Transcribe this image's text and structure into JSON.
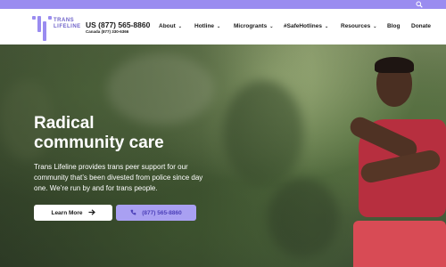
{
  "colors": {
    "topbar": "#9a8cf0",
    "logo": "#6f63c9",
    "call_button": "#a9a0f2",
    "call_text": "#4b3fb8"
  },
  "topbar": {
    "search_icon": "search-icon"
  },
  "logo": {
    "line1": "TRANS",
    "line2": "LIFELINE"
  },
  "header": {
    "phone_us": "US (877) 565-8860",
    "phone_canada": "Canada (877) 330-6366"
  },
  "nav": {
    "items": [
      {
        "label": "About",
        "dropdown": true
      },
      {
        "label": "Hotline",
        "dropdown": true
      },
      {
        "label": "Microgrants",
        "dropdown": true
      },
      {
        "label": "#SafeHotlines",
        "dropdown": true
      },
      {
        "label": "Resources",
        "dropdown": true
      },
      {
        "label": "Blog",
        "dropdown": false
      },
      {
        "label": "Donate",
        "dropdown": false
      }
    ],
    "chevron": "⌄"
  },
  "hero": {
    "title_line1": "Radical",
    "title_line2": "community care",
    "description": "Trans Lifeline provides trans peer support for our community that’s been divested from police since day one. We’re run by and for trans people.",
    "learn_more": "Learn More",
    "call_button": "(877) 565-8860"
  }
}
